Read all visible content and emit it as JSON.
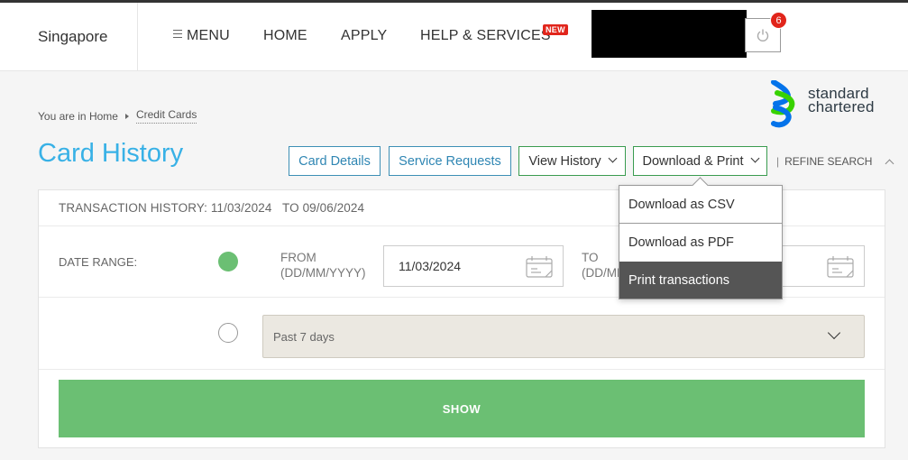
{
  "header": {
    "region": "Singapore",
    "nav": {
      "menu": "MENU",
      "home": "HOME",
      "apply": "APPLY",
      "help": "HELP & SERVICES",
      "new_badge": "NEW"
    },
    "notification_count": "6"
  },
  "logo": {
    "line1": "standard",
    "line2": "chartered"
  },
  "breadcrumb": {
    "prefix": "You are in",
    "home": "Home",
    "current": "Credit Cards"
  },
  "page_title": "Card History",
  "actions": {
    "card_details": "Card Details",
    "service_requests": "Service Requests",
    "view_history": "View History",
    "download_print": "Download & Print",
    "refine_search": "REFINE SEARCH"
  },
  "panel": {
    "transaction_history": "TRANSACTION HISTORY: 11/03/2024",
    "transaction_to": "TO 09/06/2024",
    "date_range_label": "DATE RANGE:",
    "from_label": "FROM",
    "from_format": "(DD/MM/YYYY)",
    "from_value": "11/03/2024",
    "to_label": "TO",
    "to_format": "(DD/MM/YYYY)",
    "period_value": "Past 7 days",
    "show_button": "SHOW"
  },
  "dropdown": {
    "items": [
      "Download as CSV",
      "Download as PDF",
      "Print transactions"
    ]
  },
  "colors": {
    "title_blue": "#38b1e6",
    "green": "#6bbf73",
    "badge_red": "#e1251b"
  }
}
